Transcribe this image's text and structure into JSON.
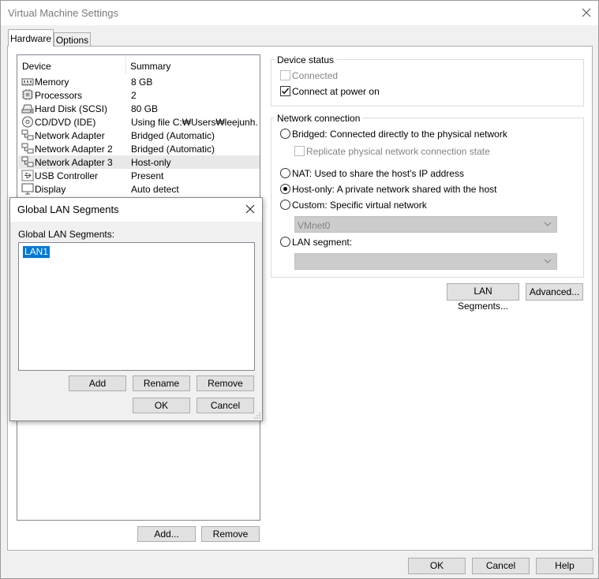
{
  "window": {
    "title": "Virtual Machine Settings"
  },
  "tabs": [
    {
      "label": "Hardware"
    },
    {
      "label": "Options"
    }
  ],
  "device_list": {
    "headers": {
      "device": "Device",
      "summary": "Summary"
    },
    "rows": [
      {
        "icon": "memory-icon",
        "name": "Memory",
        "summary": "8 GB"
      },
      {
        "icon": "processor-icon",
        "name": "Processors",
        "summary": "2"
      },
      {
        "icon": "hard-disk-icon",
        "name": "Hard Disk (SCSI)",
        "summary": "80 GB"
      },
      {
        "icon": "cd-dvd-icon",
        "name": "CD/DVD (IDE)",
        "summary": "Using file C:₩Users₩leejunh..."
      },
      {
        "icon": "network-adapter-icon",
        "name": "Network Adapter",
        "summary": "Bridged (Automatic)"
      },
      {
        "icon": "network-adapter-icon",
        "name": "Network Adapter 2",
        "summary": "Bridged (Automatic)"
      },
      {
        "icon": "network-adapter-icon",
        "name": "Network Adapter 3",
        "summary": "Host-only"
      },
      {
        "icon": "usb-controller-icon",
        "name": "USB Controller",
        "summary": "Present"
      },
      {
        "icon": "display-icon",
        "name": "Display",
        "summary": "Auto detect"
      }
    ],
    "selected_index": 6,
    "add_label": "Add...",
    "remove_label": "Remove"
  },
  "device_status": {
    "title": "Device status",
    "connected": {
      "label": "Connected",
      "checked": false,
      "disabled": true
    },
    "connect_at_power_on": {
      "label": "Connect at power on",
      "checked": true
    }
  },
  "network_connection": {
    "title": "Network connection",
    "bridged": {
      "label": "Bridged: Connected directly to the physical network",
      "selected": false
    },
    "replicate": {
      "label": "Replicate physical network connection state",
      "checked": false,
      "disabled": true
    },
    "nat": {
      "label": "NAT: Used to share the host's IP address",
      "selected": false
    },
    "host_only": {
      "label": "Host-only: A private network shared with the host",
      "selected": true
    },
    "custom": {
      "label": "Custom: Specific virtual network",
      "selected": false,
      "value": "VMnet0"
    },
    "lan_segment": {
      "label": "LAN segment:",
      "selected": false,
      "value": ""
    }
  },
  "network_buttons": {
    "lan_segments_label": "LAN Segments...",
    "advanced_label": "Advanced..."
  },
  "footer": {
    "ok_label": "OK",
    "cancel_label": "Cancel",
    "help_label": "Help"
  },
  "lan_dialog": {
    "title": "Global LAN Segments",
    "list_label": "Global LAN Segments:",
    "items": [
      "LAN1"
    ],
    "add_label": "Add",
    "rename_label": "Rename",
    "remove_label": "Remove",
    "ok_label": "OK",
    "cancel_label": "Cancel"
  },
  "icons": {
    "close": "close-icon",
    "dropdown": "chevron-down-icon",
    "resize": "resize-grip-icon"
  }
}
